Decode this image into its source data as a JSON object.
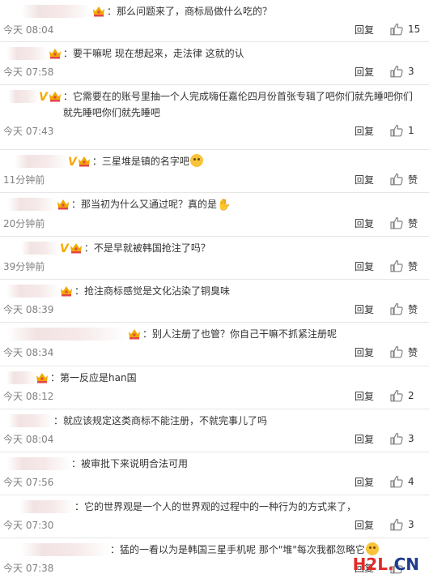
{
  "ui": {
    "reply_label": "回复",
    "like_label": "赞",
    "accent_verified": "#f7a800",
    "time_color": "#808080"
  },
  "comments": [
    {
      "user_badges": [
        "crown"
      ],
      "text": "：那么问题来了，商标局做什么吃的？",
      "emoji": "",
      "time": "今天 08:04",
      "likes": "15"
    },
    {
      "user_badges": [
        "crown"
      ],
      "text": "：要干嘛呢 现在想起来，走法律 这就的认",
      "emoji": "",
      "time": "今天 07:58",
      "likes": "3"
    },
    {
      "user_badges": [
        "v",
        "crown"
      ],
      "text": "：它需要在的账号里抽一个人完成嗨任嘉伦四月份首张专辑了吧你们就先睡吧你们就先睡吧你们就先睡吧",
      "emoji": "",
      "time": "今天 07:43",
      "likes": "1"
    },
    {
      "user_badges": [
        "v",
        "crown"
      ],
      "text": "：三星堆是镇的名字吧",
      "emoji": "face",
      "time": "11分钟前",
      "likes": "赞"
    },
    {
      "user_badges": [
        "crown"
      ],
      "text": "：那当初为什么又通过呢？真的是",
      "emoji": "hand",
      "time": "20分钟前",
      "likes": "赞"
    },
    {
      "user_badges": [
        "v",
        "crown"
      ],
      "text": "：不是早就被韩国抢注了吗？",
      "emoji": "",
      "time": "39分钟前",
      "likes": "赞"
    },
    {
      "user_badges": [
        "crown"
      ],
      "text": "：抢注商标感觉是文化沾染了铜臭味",
      "emoji": "",
      "time": "今天 08:39",
      "likes": "赞"
    },
    {
      "user_badges": [
        "crown"
      ],
      "text": "：别人注册了也管？你自己干嘛不抓紧注册呢",
      "emoji": "",
      "time": "今天 08:34",
      "likes": "赞"
    },
    {
      "user_badges": [
        "crown"
      ],
      "text": "：第一反应是han国",
      "emoji": "",
      "time": "今天 08:12",
      "likes": "2"
    },
    {
      "user_badges": [],
      "text": "：就应该规定这类商标不能注册，不就完事儿了吗",
      "emoji": "",
      "time": "今天 08:04",
      "likes": "3"
    },
    {
      "user_badges": [],
      "text": "：被审批下来说明合法可用",
      "emoji": "",
      "time": "今天 07:56",
      "likes": "4"
    },
    {
      "user_badges": [],
      "text": "：它的世界观是一个人的世界观的过程中的一种行为的方式来了，",
      "emoji": "",
      "time": "今天 07:30",
      "likes": "3"
    },
    {
      "user_badges": [],
      "text": "：猛的一看以为是韩国三星手机呢 那个\"堆\"每次我都忽略它",
      "emoji": "face",
      "time": "今天 07:38",
      "likes": ""
    }
  ],
  "watermark": {
    "part1": "H2L",
    "dot": ".",
    "part2": "CN"
  }
}
